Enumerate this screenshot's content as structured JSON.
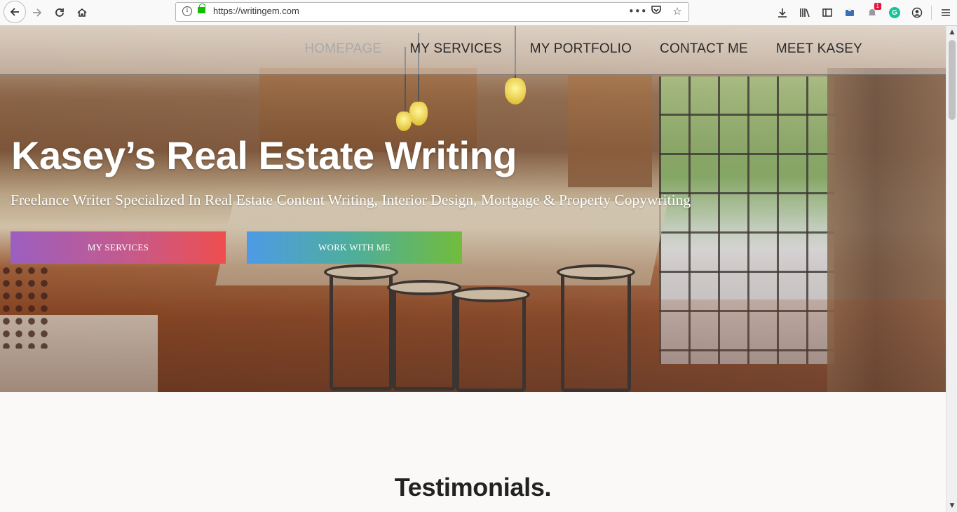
{
  "browser": {
    "url": "https://writingem.com",
    "notification_count": "1",
    "grammarly_letter": "G",
    "icons": {
      "back": "back-arrow-icon",
      "forward": "forward-arrow-icon",
      "reload": "reload-icon",
      "home": "home-icon",
      "info": "info-icon",
      "lock": "lock-icon",
      "more": "more-icon",
      "pocket": "pocket-icon",
      "bookmark": "star-icon",
      "download": "download-icon",
      "library": "library-icon",
      "sidebar": "sidebar-icon",
      "menu": "hamburger-menu-icon"
    }
  },
  "nav": {
    "items": [
      {
        "label": "HOMEPAGE",
        "active": true
      },
      {
        "label": "MY SERVICES",
        "active": false
      },
      {
        "label": "MY PORTFOLIO",
        "active": false
      },
      {
        "label": "CONTACT ME",
        "active": false
      },
      {
        "label": "MEET KASEY",
        "active": false
      }
    ]
  },
  "hero": {
    "title": "Kasey’s Real Estate Writing",
    "subtitle": "Freelance Writer Specialized In Real Estate Content Writing, Interior Design, Mortgage & Property Copywriting",
    "buttons": {
      "services": "MY SERVICES",
      "work": "WORK WITH ME"
    }
  },
  "sections": {
    "testimonials_title": "Testimonials."
  },
  "colors": {
    "services_gradient": [
      "#9b5fc0",
      "#ef4e4e"
    ],
    "work_gradient": [
      "#4d9be6",
      "#72bc3c"
    ],
    "nav_active": "#a9a9a9"
  }
}
